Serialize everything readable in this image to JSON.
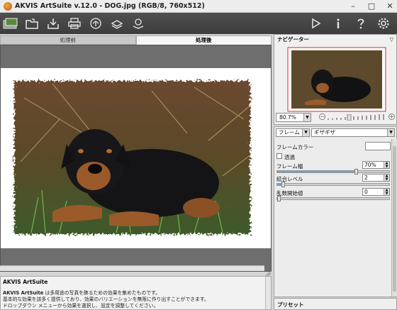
{
  "window": {
    "title": "AKVIS ArtSuite v.12.0 - DOG.jpg (RGB/8, 760x512)",
    "controls": [
      "–",
      "□",
      "✕"
    ]
  },
  "toolbar": {
    "left_icons": [
      "open-image-icon",
      "open-folder-icon",
      "save-icon",
      "print-icon",
      "share-icon",
      "batch-icon",
      "export-icon"
    ],
    "right_icons": [
      "run-icon",
      "info-icon",
      "help-icon",
      "preferences-icon"
    ]
  },
  "tabs": {
    "before": "処理前",
    "after": "処理後"
  },
  "navigator": {
    "title": "ナビゲーター",
    "zoom": "80.7%"
  },
  "settings": {
    "category": "フレーム",
    "frame_type": "ギザギザ",
    "frame_color_label": "フレームカラー",
    "transparent_label": "透過",
    "frame_width_label": "フレーム幅",
    "frame_width_value": "70%",
    "frame_width_level": 0.7,
    "blend_level_label": "結合レベル",
    "blend_level_value": "2",
    "blend_level_fraction": 0.05,
    "random_seed_label": "乱数開始値",
    "random_seed_value": "0",
    "random_seed_fraction": 0.0
  },
  "info": {
    "title": "AKVIS ArtSuite",
    "line1_bold": "AKVIS ArtSuite",
    "line1_rest": " は多用途の写真を飾るための効果を集めたものです。",
    "line2": "基本的な効果を該多く提供しており、効果のバリエーションを無限に作り出すことができます。",
    "line3": "ドロップダウン メニューから効果を選択し、設定を調整してください。"
  },
  "presets": {
    "title": "プリセット"
  }
}
